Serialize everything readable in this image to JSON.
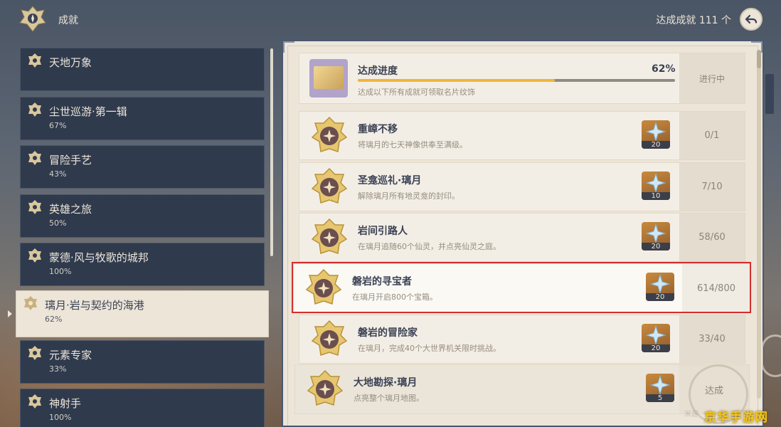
{
  "header": {
    "title": "成就",
    "count_label": "达成成就 111 个"
  },
  "sidebar": {
    "categories": [
      {
        "name": "天地万象",
        "percent": ""
      },
      {
        "name": "尘世巡游·第一辑",
        "percent": "67%"
      },
      {
        "name": "冒险手艺",
        "percent": "43%"
      },
      {
        "name": "英雄之旅",
        "percent": "50%"
      },
      {
        "name": "蒙德·风与牧歌的城邦",
        "percent": "100%"
      },
      {
        "name": "璃月·岩与契约的海港",
        "percent": "62%"
      },
      {
        "name": "元素专家",
        "percent": "33%"
      },
      {
        "name": "神射手",
        "percent": "100%"
      }
    ],
    "selected_index": 5
  },
  "progress": {
    "title": "达成进度",
    "percent_label": "62%",
    "fill_fraction": 0.62,
    "description": "达成以下所有成就可领取名片纹饰",
    "state": "进行中"
  },
  "achievements": [
    {
      "title": "重嶂不移",
      "desc": "将璃月的七天神像供奉至满级。",
      "reward": "20",
      "progress": "0/1"
    },
    {
      "title": "圣龛巡礼·璃月",
      "desc": "解除璃月所有地灵龛的封印。",
      "reward": "10",
      "progress": "7/10"
    },
    {
      "title": "岩间引路人",
      "desc": "在璃月追随60个仙灵，并点亮仙灵之庭。",
      "reward": "20",
      "progress": "58/60"
    },
    {
      "title": "磐岩的寻宝者",
      "desc": "在璃月开启800个宝箱。",
      "reward": "20",
      "progress": "614/800"
    },
    {
      "title": "磐岩的冒险家",
      "desc": "在璃月，完成40个大世界机关限时挑战。",
      "reward": "20",
      "progress": "33/40"
    },
    {
      "title": "大地勘探·璃月",
      "desc": "点亮整个璃月地图。",
      "reward": "5",
      "progress": "达成"
    }
  ],
  "watermark": {
    "brand": "京华手游网",
    "mark": "米游"
  },
  "colors": {
    "accent": "#f2b53a",
    "panel": "#ece5d8",
    "sidebar_item": "#2f3a4d",
    "highlight_frame": "#d32f2f"
  },
  "icons": {
    "emblem": "achievement-emblem-icon",
    "back": "back-arrow-icon",
    "reward": "primogem-icon",
    "medal": "geo-medal-icon",
    "category": "category-badge-icon"
  }
}
